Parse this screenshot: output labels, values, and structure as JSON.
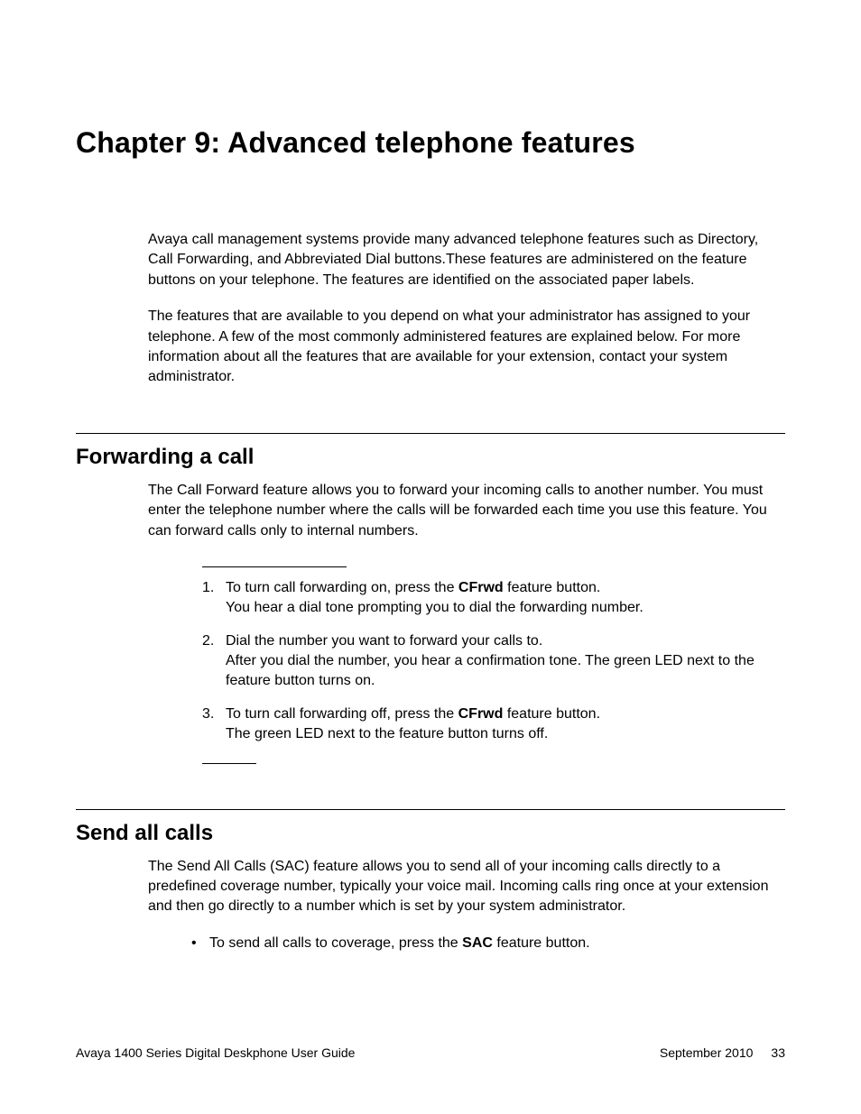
{
  "chapter": {
    "title": "Chapter 9:  Advanced telephone features"
  },
  "intro": {
    "p1": "Avaya call management systems provide many advanced telephone features such as Directory, Call Forwarding, and Abbreviated Dial buttons.These features are administered on the feature buttons on your telephone. The features are identified on the associated paper labels.",
    "p2": "The features that are available to you depend on what your administrator has assigned to your telephone. A few of the most commonly administered features are explained below. For more information about all the features that are available for your extension, contact your system administrator."
  },
  "forwarding": {
    "title": "Forwarding a call",
    "p1": "The Call Forward feature allows you to forward your incoming calls to another number. You must enter the telephone number where the calls will be forwarded each time you use this feature. You can forward calls only to internal numbers.",
    "steps": {
      "s1": {
        "num": "1.",
        "a": "To turn call forwarding on, press the ",
        "bold": "CFrwd",
        "b": " feature button.",
        "line2": "You hear a dial tone prompting you to dial the forwarding number."
      },
      "s2": {
        "num": "2.",
        "a": "Dial the number you want to forward your calls to.",
        "line2": "After you dial the number, you hear a confirmation tone. The green LED next to the feature button turns on."
      },
      "s3": {
        "num": "3.",
        "a": "To turn call forwarding off, press the ",
        "bold": "CFrwd",
        "b": " feature button.",
        "line2": "The green LED next to the feature button turns off."
      }
    }
  },
  "sendall": {
    "title": "Send all calls",
    "p1": "The Send All Calls (SAC) feature allows you to send all of your incoming calls directly to a predefined coverage number, typically your voice mail. Incoming calls ring once at your extension and then go directly to a number which is set by your system administrator.",
    "bullet": {
      "mark": "•",
      "a": "To send all calls to coverage, press the ",
      "bold": "SAC",
      "b": " feature button."
    }
  },
  "footer": {
    "left": "Avaya 1400 Series Digital Deskphone User Guide",
    "date": "September 2010",
    "page": "33"
  }
}
